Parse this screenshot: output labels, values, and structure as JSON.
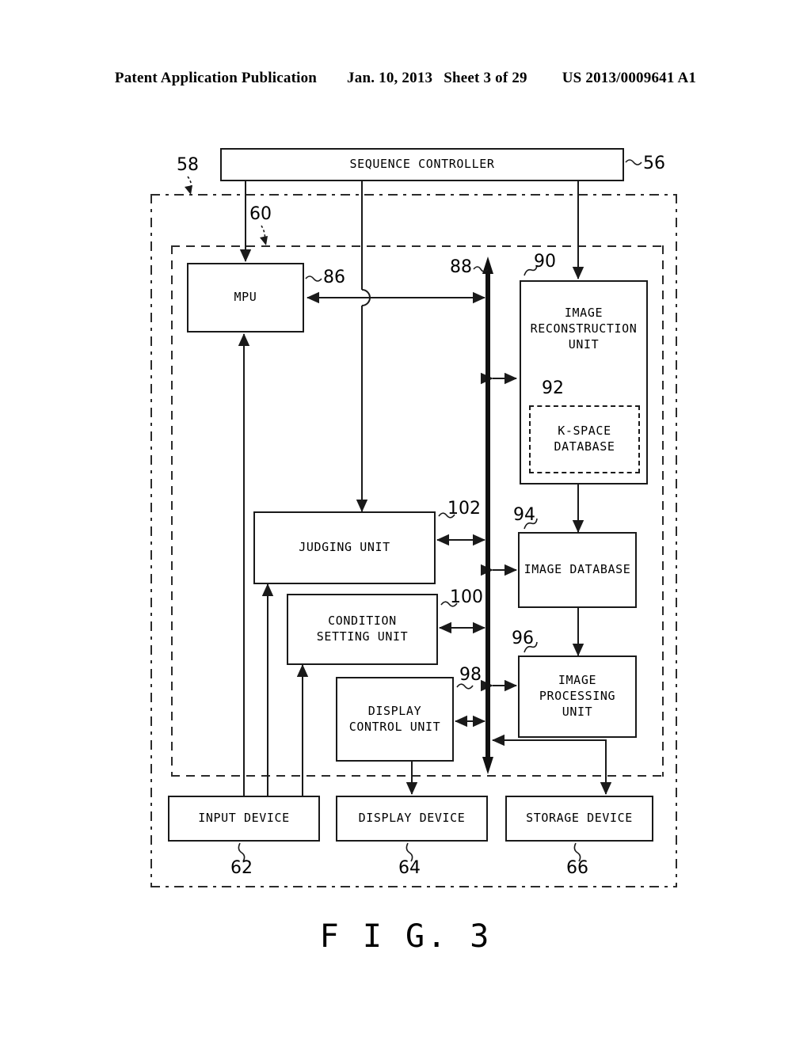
{
  "header": {
    "publication": "Patent Application Publication",
    "date": "Jan. 10, 2013",
    "sheet": "Sheet 3 of 29",
    "patent_number": "US 2013/0009641 A1"
  },
  "figure": {
    "caption": "F I G. 3"
  },
  "blocks": {
    "sequence_controller": {
      "label": "SEQUENCE CONTROLLER",
      "ref": "56"
    },
    "mpu": {
      "label": "MPU",
      "ref": "86"
    },
    "image_reconstruction_unit": {
      "label": "IMAGE\nRECONSTRUCTION\nUNIT",
      "ref": "90"
    },
    "k_space_database": {
      "label": "K-SPACE\nDATABASE",
      "ref": "92"
    },
    "image_database": {
      "label": "IMAGE DATABASE",
      "ref": "94"
    },
    "image_processing_unit": {
      "label": "IMAGE\nPROCESSING\nUNIT",
      "ref": "96"
    },
    "judging_unit": {
      "label": "JUDGING UNIT",
      "ref": "102"
    },
    "condition_setting_unit": {
      "label": "CONDITION\nSETTING UNIT",
      "ref": "100"
    },
    "display_control_unit": {
      "label": "DISPLAY\nCONTROL UNIT",
      "ref": "98"
    },
    "input_device": {
      "label": "INPUT DEVICE",
      "ref": "62"
    },
    "display_device": {
      "label": "DISPLAY DEVICE",
      "ref": "64"
    },
    "storage_device": {
      "label": "STORAGE DEVICE",
      "ref": "66"
    }
  },
  "boundaries": {
    "outer_system": {
      "ref": "58"
    },
    "inner_computer": {
      "ref": "60"
    }
  },
  "bus": {
    "ref": "88"
  },
  "colors": {
    "ink": "#1a1a1a",
    "paper": "#ffffff",
    "boundary": "#2b2b2b"
  }
}
